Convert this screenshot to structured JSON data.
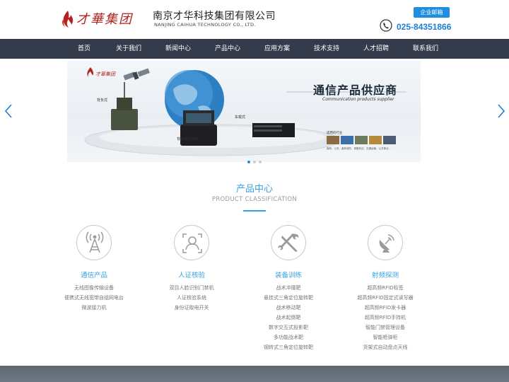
{
  "header": {
    "logo_text": "才華集团",
    "company_name_cn": "南京才华科技集团有限公司",
    "company_name_en": "NANJING CAIHUA TECHNOLOGY CO., LTD.",
    "email_button": "企业邮箱",
    "phone": "025-84351866"
  },
  "nav": {
    "items": [
      "首页",
      "关于我们",
      "新闻中心",
      "产品中心",
      "应用方案",
      "技术支持",
      "人才招聘",
      "联系我们"
    ]
  },
  "banner": {
    "logo_text": "才華集团",
    "headline": "通信产品供应商",
    "headline_en": "Communication products supplier",
    "labels": [
      "背负式",
      "背负式发射机",
      "车载式"
    ],
    "industry_title": "适用的行业",
    "industry_text": "森林、公安、森林消防、城管执法、交通运输、公共事业..."
  },
  "products": {
    "title": "产品中心",
    "subtitle": "PRODUCT CLASSIFICATION",
    "categories": [
      {
        "icon": "antenna-tower-icon",
        "name": "通信产品",
        "items": [
          "无线图像传输设备",
          "便携式无线宽带自组网电台",
          "微波接力机"
        ]
      },
      {
        "icon": "person-id-icon",
        "name": "人证核验",
        "items": [
          "双目人脸识别门禁机",
          "人证核验系统",
          "身份证取电开关"
        ]
      },
      {
        "icon": "tools-icon",
        "name": "装备训练",
        "items": [
          "战术冲撞靶",
          "悬挂式三角定位旋转靶",
          "战术移动靶",
          "战术起倒靶",
          "数字交互式投影靶",
          "多功能战术靶",
          "钢转式三角定位旋转靶"
        ]
      },
      {
        "icon": "satellite-dish-icon",
        "name": "射频探测",
        "items": [
          "超高频RFID标签",
          "超高频RFID固定式读写器",
          "超高频RFID发卡器",
          "超高频RFID手持机",
          "智能门禁管理设备",
          "智能枪弹柜",
          "货架式自动盘点天线"
        ]
      }
    ]
  },
  "colors": {
    "accent": "#3aa1e3",
    "nav_bg": "#343c4c",
    "brand_red": "#b5211c",
    "phone_blue": "#1f7fd4"
  }
}
